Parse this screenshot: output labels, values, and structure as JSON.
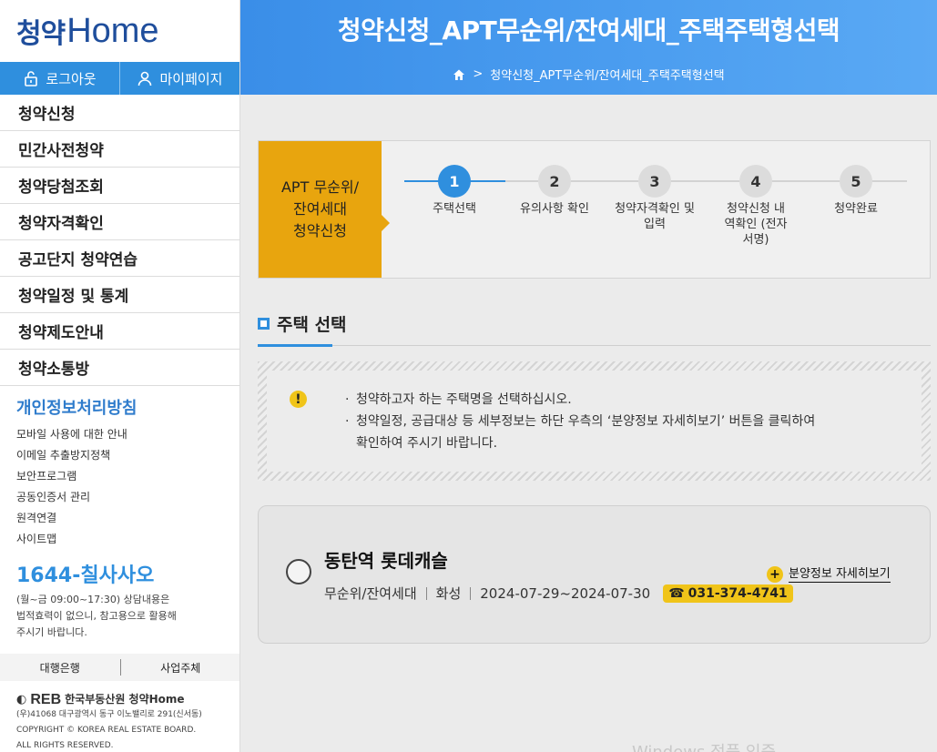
{
  "sidebar": {
    "logo_ko": "청약",
    "logo_en": "Home",
    "logout_label": "로그아웃",
    "mypage_label": "마이페이지",
    "menu": [
      "청약신청",
      "민간사전청약",
      "청약당첨조회",
      "청약자격확인",
      "공고단지 청약연습",
      "청약일정 및 통계",
      "청약제도안내",
      "청약소통방"
    ],
    "privacy_heading": "개인정보처리방침",
    "privacy_links": [
      "모바일 사용에 대한 안내",
      "이메일 추출방지정책",
      "보안프로그램",
      "공동인증서 관리",
      "원격연결",
      "사이트맵"
    ],
    "phone_number": "1644-칠사사오",
    "phone_note_1": "(월~금 09:00~17:30) 상담내용은",
    "phone_note_2": "법적효력이 없으니, 참고용으로 활용해",
    "phone_note_3": "주시기 바랍니다.",
    "bank_link": "대행은행",
    "builder_link": "사업주체",
    "footer_logo": "REB",
    "footer_org": "한국부동산원 청약Home",
    "footer_address": "(우)41068 대구광역시 동구 이노밸리로 291(신서동)",
    "footer_copyright_1": "COPYRIGHT © KOREA REAL ESTATE BOARD.",
    "footer_copyright_2": "ALL RIGHTS RESERVED."
  },
  "header": {
    "title": "청약신청_APT무순위/잔여세대_주택주택형선택",
    "breadcrumb": "청약신청_APT무순위/잔여세대_주택주택형선택"
  },
  "steps": {
    "label_1": "APT 무순위/",
    "label_2": "잔여세대",
    "label_3": "청약신청",
    "items": [
      {
        "num": "1",
        "label": "주택선택"
      },
      {
        "num": "2",
        "label": "유의사항 확인"
      },
      {
        "num": "3",
        "label": "청약자격확인 및 입력"
      },
      {
        "num": "4",
        "label": "청약신청 내역확인 (전자서명)"
      },
      {
        "num": "5",
        "label": "청약완료"
      }
    ]
  },
  "section": {
    "title": "주택 선택"
  },
  "notice": {
    "icon": "!",
    "line_1": "청약하고자 하는 주택명을 선택하십시오.",
    "line_2": "청약일정, 공급대상 등 세부정보는 하단 우측의 ‘분양정보 자세히보기’ 버튼을 클릭하여",
    "line_3": "확인하여 주시기 바랍니다."
  },
  "house": {
    "name": "동탄역 롯데캐슬",
    "type": "무순위/잔여세대",
    "region": "화성",
    "period": "2024-07-29~2024-07-30",
    "phone": "031-374-4741",
    "detail_button": "분양정보 자세히보기"
  },
  "watermark": "Windows 정품 인증",
  "colors": {
    "primary": "#2f8fde",
    "accent": "#e8a50e",
    "yellow": "#f0c419"
  }
}
